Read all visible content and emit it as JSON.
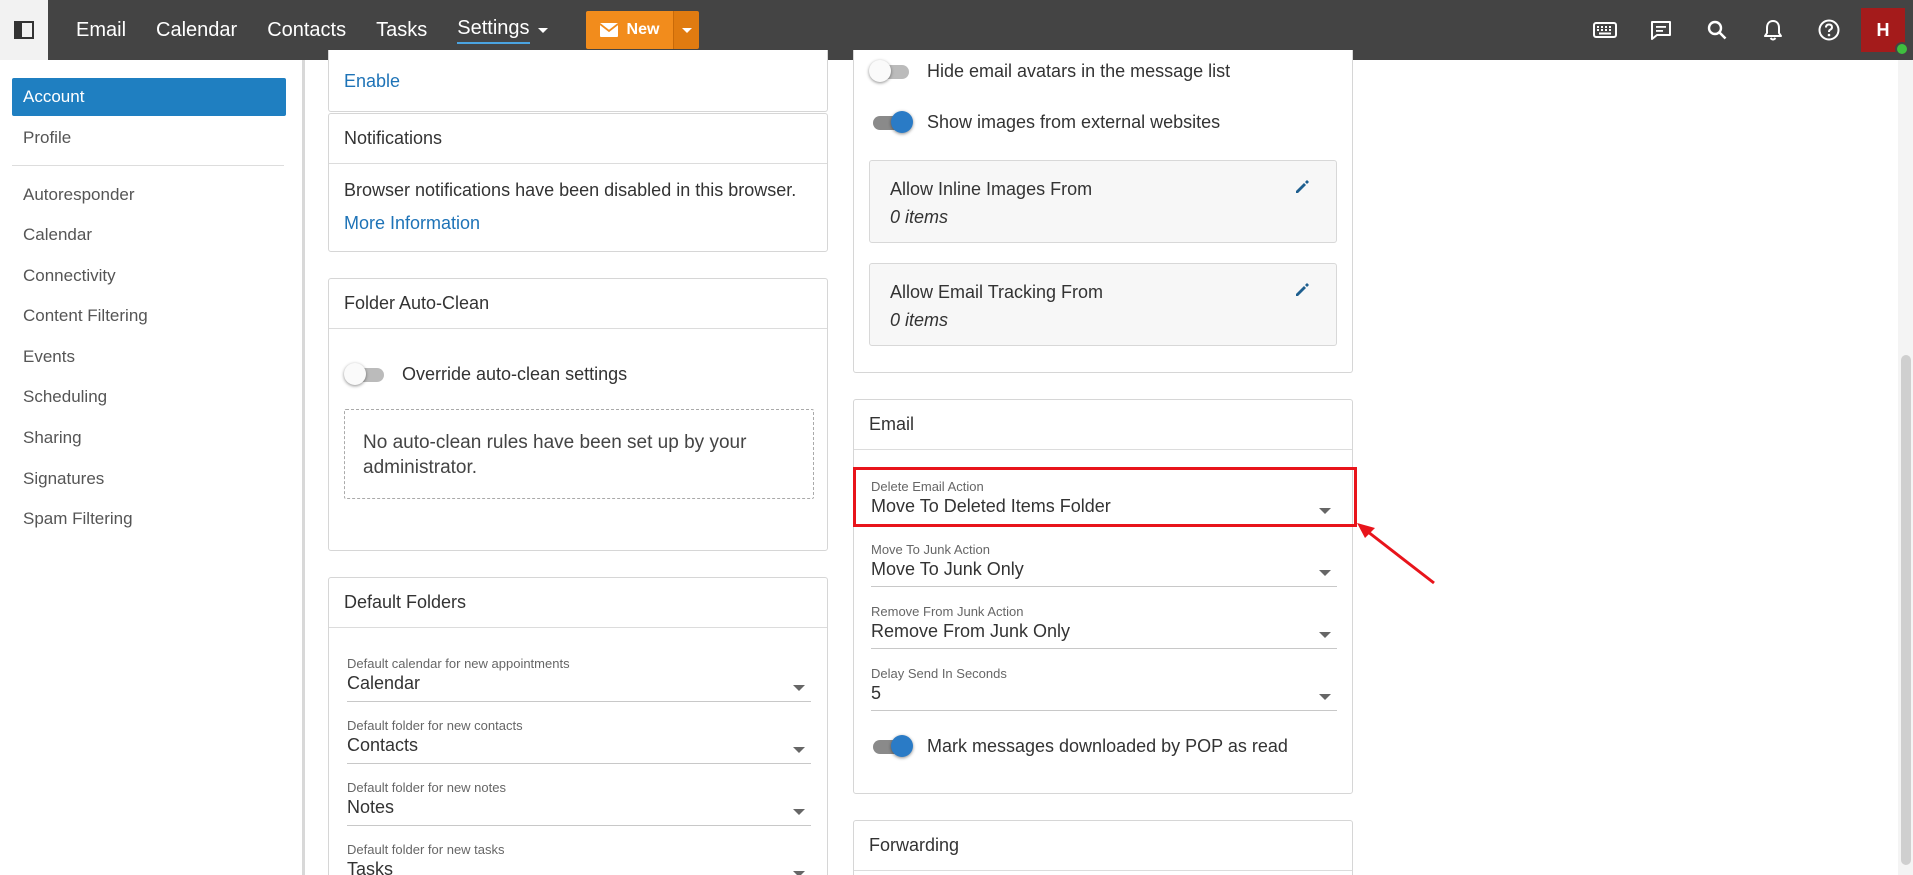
{
  "topbar": {
    "nav": [
      "Email",
      "Calendar",
      "Contacts",
      "Tasks",
      "Settings"
    ],
    "new_label": "New",
    "avatar_initial": "H"
  },
  "sidebar": {
    "items": [
      "Account",
      "Profile",
      "Autoresponder",
      "Calendar",
      "Connectivity",
      "Content Filtering",
      "Events",
      "Scheduling",
      "Sharing",
      "Signatures",
      "Spam Filtering"
    ]
  },
  "left_col": {
    "enable_link": "Enable",
    "notifications": {
      "title": "Notifications",
      "message": "Browser notifications have been disabled in this browser.",
      "more_link": "More Information"
    },
    "auto_clean": {
      "title": "Folder Auto-Clean",
      "toggle_label": "Override auto-clean settings",
      "empty_message": "No auto-clean rules have been set up by your administrator."
    },
    "default_folders": {
      "title": "Default Folders",
      "fields": [
        {
          "label": "Default calendar for new appointments",
          "value": "Calendar"
        },
        {
          "label": "Default folder for new contacts",
          "value": "Contacts"
        },
        {
          "label": "Default folder for new notes",
          "value": "Notes"
        },
        {
          "label": "Default folder for new tasks",
          "value": "Tasks"
        }
      ]
    }
  },
  "right_col": {
    "toggles": [
      {
        "label": "Hide email avatars in the message list",
        "on": false
      },
      {
        "label": "Show images from external websites",
        "on": true
      }
    ],
    "inline_images": {
      "title": "Allow Inline Images From",
      "count": "0 items"
    },
    "email_tracking": {
      "title": "Allow Email Tracking From",
      "count": "0 items"
    },
    "email": {
      "title": "Email",
      "fields": [
        {
          "label": "Delete Email Action",
          "value": "Move To Deleted Items Folder"
        },
        {
          "label": "Move To Junk Action",
          "value": "Move To Junk Only"
        },
        {
          "label": "Remove From Junk Action",
          "value": "Remove From Junk Only"
        },
        {
          "label": "Delay Send In Seconds",
          "value": "5"
        }
      ],
      "pop_toggle_label": "Mark messages downloaded by POP as read"
    },
    "forwarding": {
      "title": "Forwarding"
    }
  },
  "colors": {
    "accent": "#1f7fc1",
    "new_button": "#f28c1c",
    "highlight": "#e8141b",
    "avatar": "#a41b1b"
  }
}
